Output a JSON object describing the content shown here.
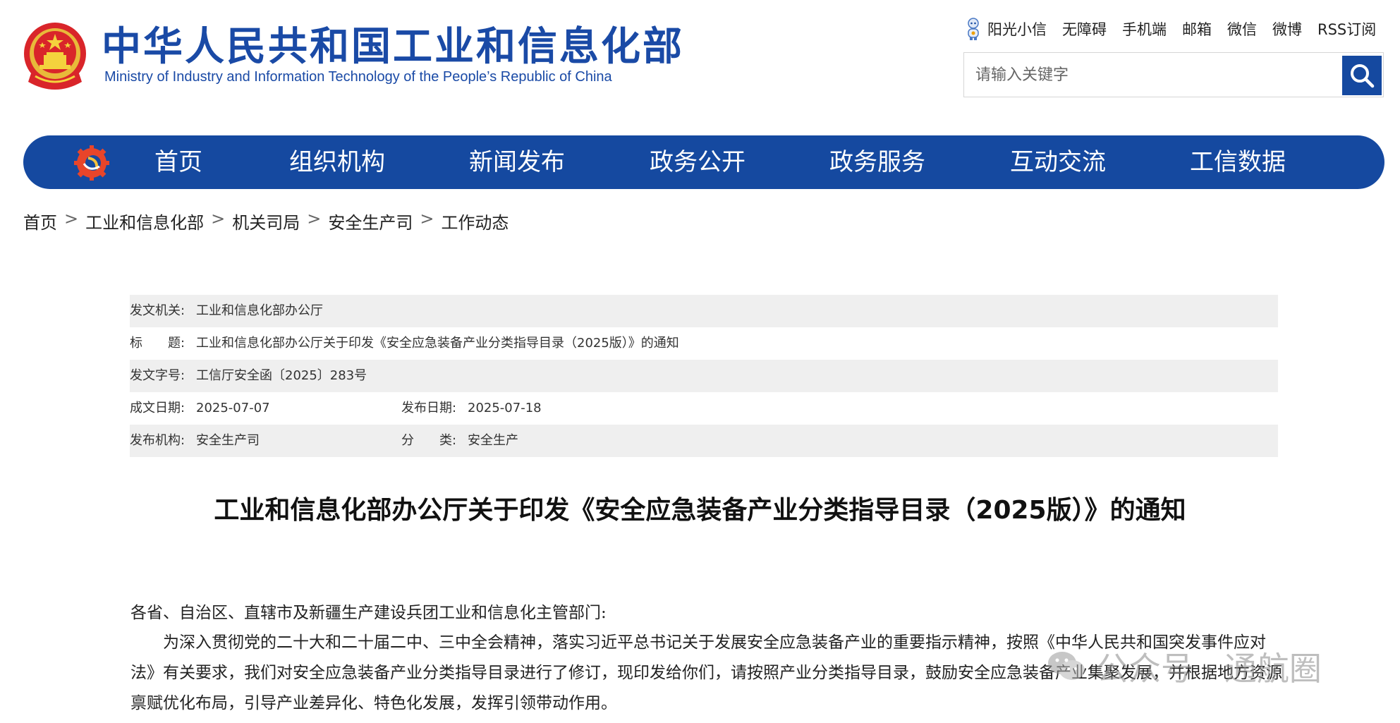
{
  "header": {
    "site_title": "中华人民共和国工业和信息化部",
    "site_subtitle": "Ministry of Industry and Information Technology of the People’s Republic of China",
    "top_links": [
      "阳光小信",
      "无障碍",
      "手机端",
      "邮箱",
      "微信",
      "微博",
      "RSS订阅"
    ],
    "search_placeholder": "请输入关键字"
  },
  "nav": {
    "items": [
      "首页",
      "组织机构",
      "新闻发布",
      "政务公开",
      "政务服务",
      "互动交流",
      "工信数据"
    ]
  },
  "breadcrumb": [
    "首页",
    "工业和信息化部",
    "机关司局",
    "安全生产司",
    "工作动态"
  ],
  "meta": {
    "issuer_label": "发文机关:",
    "issuer": "工业和信息化部办公厅",
    "title_label": "标　　题:",
    "title": "工业和信息化部办公厅关于印发《安全应急装备产业分类指导目录（2025版）》的通知",
    "doc_no_label": "发文字号:",
    "doc_no": "工信厅安全函〔2025〕283号",
    "written_label": "成文日期:",
    "written": "2025-07-07",
    "published_label": "发布日期:",
    "published": "2025-07-18",
    "org_label": "发布机构:",
    "org": "安全生产司",
    "category_label": "分　　类:",
    "category": "安全生产"
  },
  "article": {
    "title": "工业和信息化部办公厅关于印发《安全应急装备产业分类指导目录（2025版）》的通知",
    "salutation": "各省、自治区、直辖市及新疆生产建设兵团工业和信息化主管部门:",
    "paragraph": "为深入贯彻党的二十大和二十届二中、三中全会精神，落实习近平总书记关于发展安全应急装备产业的重要指示精神，按照《中华人民共和国突发事件应对法》有关要求，我们对安全应急装备产业分类指导目录进行了修订，现印发给你们，请按照产业分类指导目录，鼓励安全应急装备产业集聚发展，并根据地方资源禀赋优化布局，引导产业差异化、特色化发展，发挥引领带动作用。"
  },
  "watermark": {
    "text": "公众号 · 通航圈"
  },
  "colors": {
    "brand_blue": "#1549a0",
    "title_blue": "#1a4aa6",
    "meta_shade": "#efefef"
  }
}
